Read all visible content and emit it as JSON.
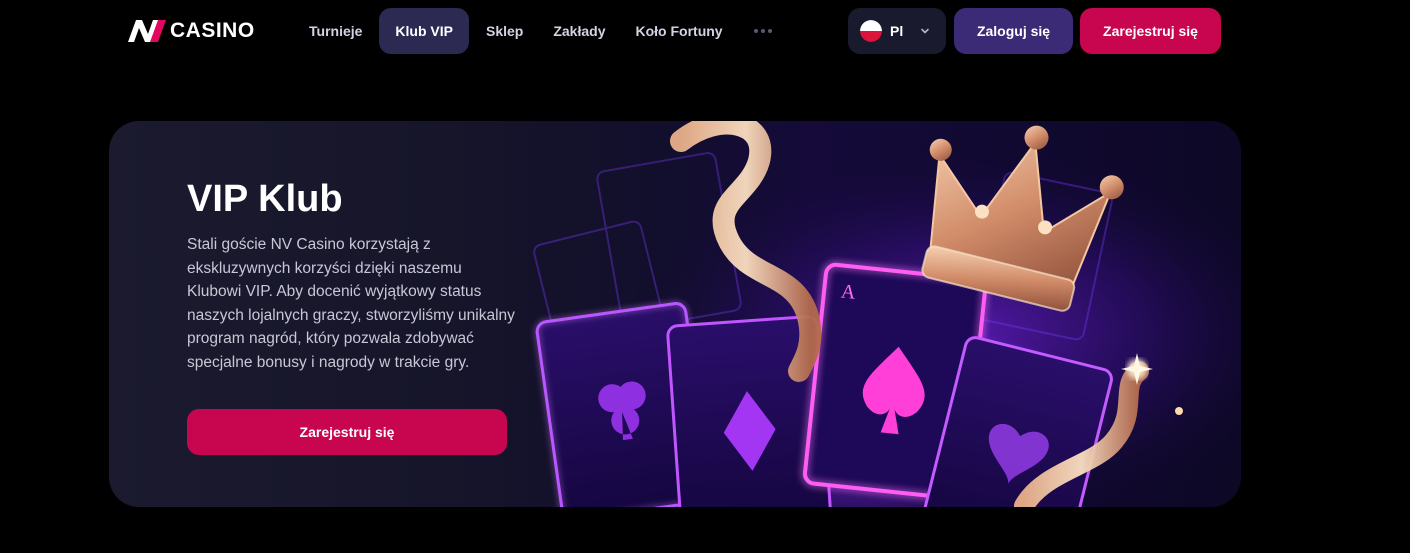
{
  "brand": {
    "logo_mark": "NV",
    "logo_text": "CASINO"
  },
  "nav": {
    "items": [
      {
        "label": "Turnieje",
        "active": false
      },
      {
        "label": "Klub VIP",
        "active": true
      },
      {
        "label": "Sklep",
        "active": false
      },
      {
        "label": "Zakłady",
        "active": false
      },
      {
        "label": "Koło Fortuny",
        "active": false
      }
    ],
    "more_icon": "more-dots-icon"
  },
  "language": {
    "code": "Pl",
    "flag": "poland-flag-icon"
  },
  "header_actions": {
    "login_label": "Zaloguj się",
    "register_label": "Zarejestruj się"
  },
  "hero": {
    "title": "VIP Klub",
    "description": "Stali goście NV Casino korzystają z ekskluzywnych korzyści dzięki naszemu Klubowi VIP. Aby docenić wyjątkowy status naszych lojalnych graczy, stworzyliśmy unikalny program nagród, który pozwala zdobywać specjalne bonusy i nagrody w trakcie gry.",
    "cta_label": "Zarejestruj się",
    "art": "vip-cards-crown-illustration"
  },
  "colors": {
    "background": "#000000",
    "accent_pink": "#c8054f",
    "login_purple": "#3b2b76",
    "nav_active": "#2c2a52",
    "card_bg": "#1b1a2e"
  }
}
